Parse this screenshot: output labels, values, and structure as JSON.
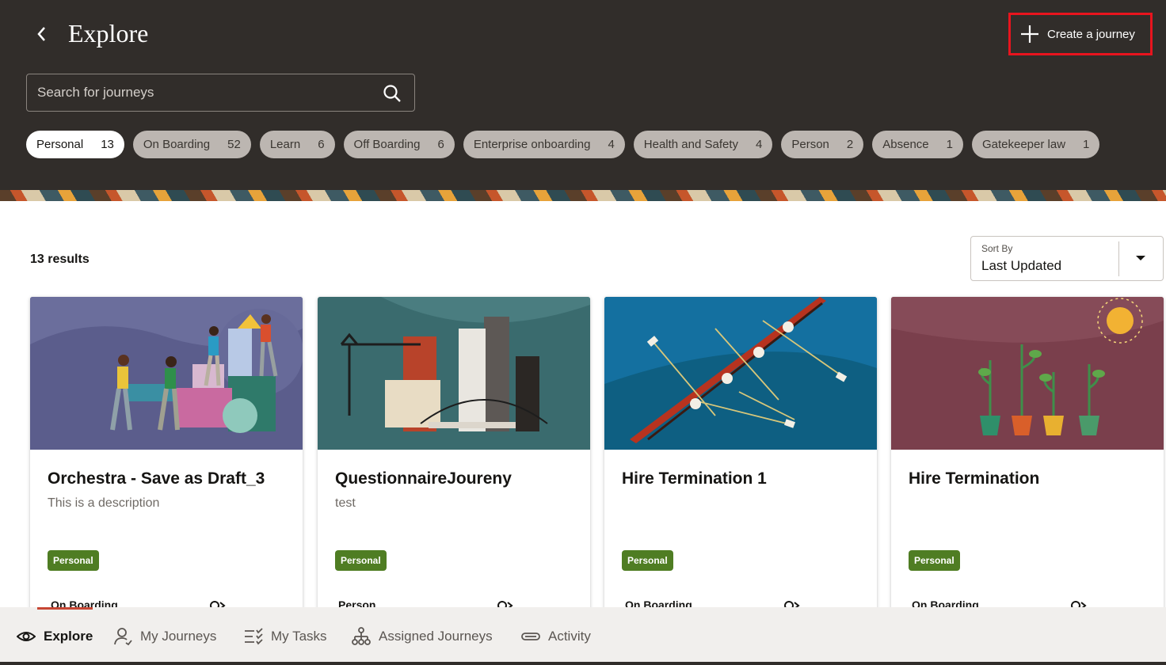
{
  "header": {
    "title": "Explore",
    "create_label": "Create a journey",
    "search_placeholder": "Search for journeys",
    "chips": [
      {
        "label": "Personal",
        "count": "13",
        "active": true
      },
      {
        "label": "On Boarding",
        "count": "52"
      },
      {
        "label": "Learn",
        "count": "6"
      },
      {
        "label": "Off Boarding",
        "count": "6"
      },
      {
        "label": "Enterprise onboarding",
        "count": "4"
      },
      {
        "label": "Health and Safety",
        "count": "4"
      },
      {
        "label": "Person",
        "count": "2"
      },
      {
        "label": "Absence",
        "count": "1"
      },
      {
        "label": "Gatekeeper law",
        "count": "1"
      }
    ]
  },
  "results": {
    "count_text": "13 results",
    "sort_label": "Sort By",
    "sort_value": "Last Updated"
  },
  "cards": [
    {
      "title": "Orchestra - Save as Draft_3",
      "description": "This is a description",
      "badge": "Personal",
      "category": "On Boarding",
      "art": "people-building-blocks"
    },
    {
      "title": "QuestionnaireJoureny",
      "description": "test",
      "badge": "Personal",
      "category": "Person",
      "art": "city-skyline-bridge"
    },
    {
      "title": "Hire Termination 1",
      "description": "",
      "badge": "Personal",
      "category": "On Boarding",
      "art": "rowing-boat"
    },
    {
      "title": "Hire Termination",
      "description": "",
      "badge": "Personal",
      "category": "On Boarding",
      "art": "growing-plants-sun"
    }
  ],
  "bottom_nav": [
    {
      "label": "Explore",
      "icon": "eye-icon",
      "active": true
    },
    {
      "label": "My Journeys",
      "icon": "person-icon"
    },
    {
      "label": "My Tasks",
      "icon": "checklist-icon"
    },
    {
      "label": "Assigned Journeys",
      "icon": "hierarchy-icon"
    },
    {
      "label": "Activity",
      "icon": "activity-icon"
    }
  ],
  "colors": {
    "header_bg": "#312d2a",
    "highlight": "#e8141e",
    "badge_green": "#4f7d23",
    "nav_indicator": "#c74634"
  }
}
